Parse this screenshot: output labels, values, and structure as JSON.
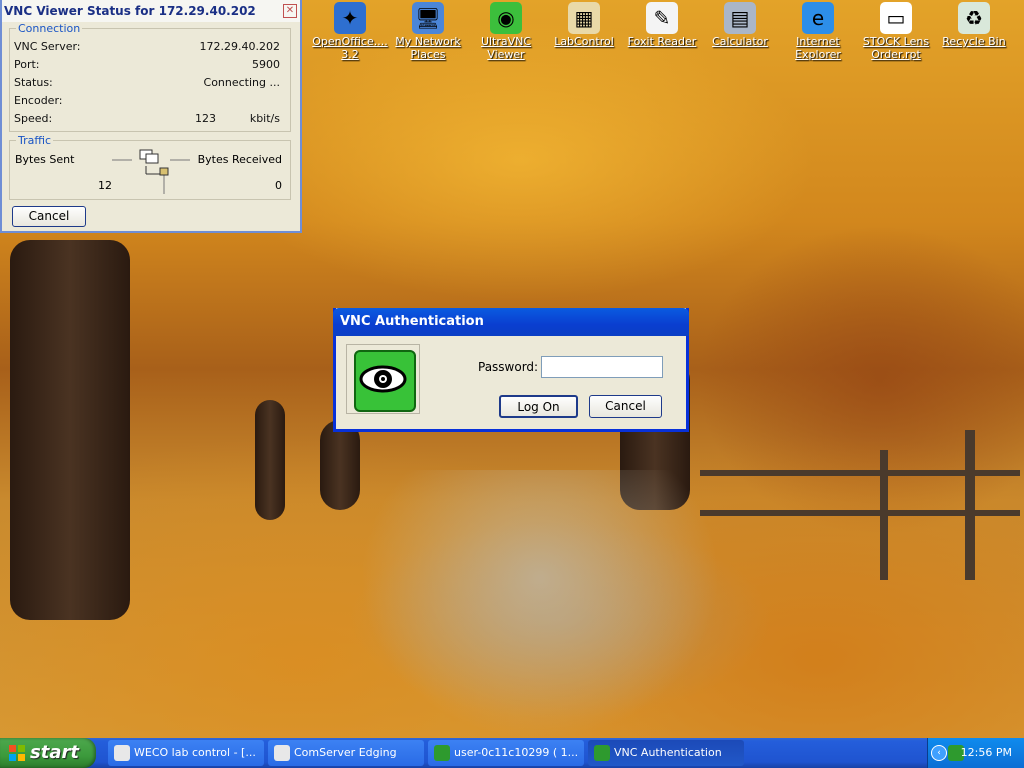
{
  "desktop": {
    "icons": [
      {
        "label": "OpenOffice....\n3.2",
        "glyph": "✦",
        "bg": "#2e6fd0"
      },
      {
        "label": "My Network\nPlaces",
        "glyph": "🖥",
        "bg": "#4b86d8"
      },
      {
        "label": "UltraVNC\nViewer",
        "glyph": "◉",
        "bg": "#3cbf3c"
      },
      {
        "label": "LabControl",
        "glyph": "▦",
        "bg": "#e9d9a8"
      },
      {
        "label": "Foxit Reader",
        "glyph": "✎",
        "bg": "#f4f4f4"
      },
      {
        "label": "Calculator",
        "glyph": "▤",
        "bg": "#aab6c8"
      },
      {
        "label": "Internet\nExplorer",
        "glyph": "e",
        "bg": "#2d8ee8"
      },
      {
        "label": "STOCK Lens\nOrder.rpt",
        "glyph": "▭",
        "bg": "#ffffff"
      },
      {
        "label": "Recycle Bin",
        "glyph": "♻",
        "bg": "#d9e8da"
      }
    ]
  },
  "status_window": {
    "title": "VNC Viewer Status for 172.29.40.202",
    "connection_legend": "Connection",
    "rows": [
      {
        "key": "VNC Server:",
        "value": "172.29.40.202",
        "unit": ""
      },
      {
        "key": "Port:",
        "value": "5900",
        "unit": ""
      },
      {
        "key": "Status:",
        "value": "Connecting ...",
        "unit": ""
      },
      {
        "key": "Encoder:",
        "value": "",
        "unit": ""
      },
      {
        "key": "Speed:",
        "value": "123",
        "unit": "kbit/s"
      }
    ],
    "traffic_legend": "Traffic",
    "bytes_sent_label": "Bytes Sent",
    "bytes_received_label": "Bytes Received",
    "bytes_sent": "12",
    "bytes_received": "0",
    "cancel_label": "Cancel"
  },
  "auth_dialog": {
    "title": "VNC Authentication",
    "password_label": "Password:",
    "password_value": "",
    "logon_label": "Log On",
    "cancel_label": "Cancel"
  },
  "taskbar": {
    "start_label": "start",
    "tasks": [
      {
        "label": "WECO lab control - [...",
        "active": false
      },
      {
        "label": "ComServer Edging",
        "active": false
      },
      {
        "label": "user-0c11c10299 ( 1...",
        "active": false
      },
      {
        "label": "VNC Authentication",
        "active": true
      }
    ],
    "clock": "12:56 PM"
  }
}
